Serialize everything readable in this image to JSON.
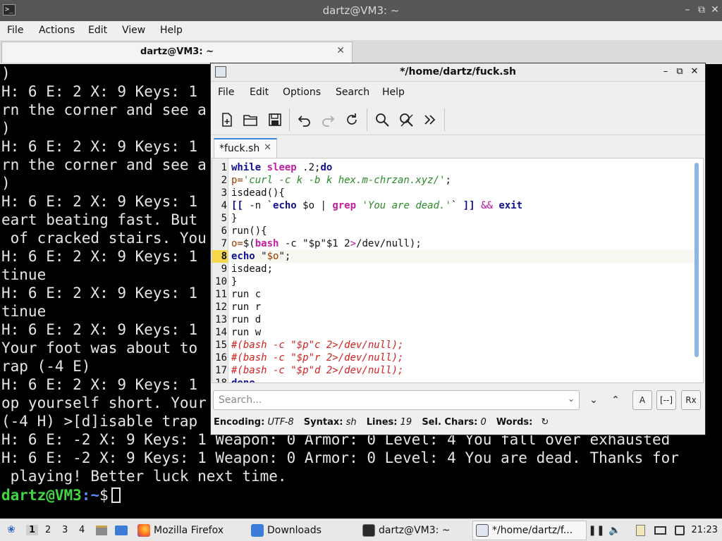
{
  "terminal": {
    "title": "dartz@VM3: ~",
    "menu": [
      "File",
      "Actions",
      "Edit",
      "View",
      "Help"
    ],
    "tab_label": "dartz@VM3: ~",
    "lines": [
      ")",
      "H: 6 E: 2 X: 9 Keys: 1",
      "rn the corner and see a",
      ")",
      "H: 6 E: 2 X: 9 Keys: 1",
      "rn the corner and see a",
      ")",
      "H: 6 E: 2 X: 9 Keys: 1",
      "eart beating fast. But",
      " of cracked stairs. You",
      "H: 6 E: 2 X: 9 Keys: 1",
      "tinue",
      "H: 6 E: 2 X: 9 Keys: 1",
      "tinue",
      "H: 6 E: 2 X: 9 Keys: 1",
      "Your foot was about to",
      "rap (-4 E)",
      "H: 6 E: 2 X: 9 Keys: 1",
      "op yourself short. Your",
      "(-4 H) >[d]isable trap",
      "H: 6 E: -2 X: 9 Keys: 1 Weapon: 0 Armor: 0 Level: 4 You fall over exhausted",
      "H: 6 E: -2 X: 9 Keys: 1 Weapon: 0 Armor: 0 Level: 4 You are dead. Thanks for",
      " playing! Better luck next time."
    ],
    "prompt_user": "dartz@VM3",
    "prompt_sep": ":",
    "prompt_path": "~",
    "prompt_symbol": "$"
  },
  "editor": {
    "title": "*/home/dartz/fuck.sh",
    "menu": [
      "File",
      "Edit",
      "Options",
      "Search",
      "Help"
    ],
    "toolbar_icons": [
      "new-file-icon",
      "open-folder-icon",
      "save-icon",
      "undo-icon",
      "redo-icon",
      "reload-icon",
      "find-icon",
      "find-replace-icon",
      "more-icon"
    ],
    "tab_label": "*fuck.sh",
    "line_numbers": [
      "1",
      "2",
      "3",
      "4",
      "5",
      "6",
      "7",
      "8",
      "9",
      "10",
      "11",
      "12",
      "13",
      "14",
      "15",
      "16",
      "17",
      "18"
    ],
    "current_line": 8,
    "search_placeholder": "Search...",
    "search_btn_case": "A",
    "search_btn_whole": "[--]",
    "search_btn_regex": "Rx",
    "status": {
      "encoding_label": "Encoding:",
      "encoding": "UTF-8",
      "syntax_label": "Syntax:",
      "syntax": "sh",
      "lines_label": "Lines:",
      "lines": "19",
      "sel_label": "Sel. Chars:",
      "sel": "0",
      "words_label": "Words:"
    }
  },
  "taskbar": {
    "workspaces": [
      "1",
      "2",
      "3",
      "4"
    ],
    "tasks": [
      "Mozilla Firefox",
      "Downloads",
      "dartz@VM3: ~",
      "*/home/dartz/f..."
    ],
    "clock": "21:23"
  },
  "colors": {
    "prompt_user": "#3fd63f",
    "prompt_path": "#5c8cff",
    "accent": "#3b86d9",
    "current_line": "#f6d84b"
  }
}
